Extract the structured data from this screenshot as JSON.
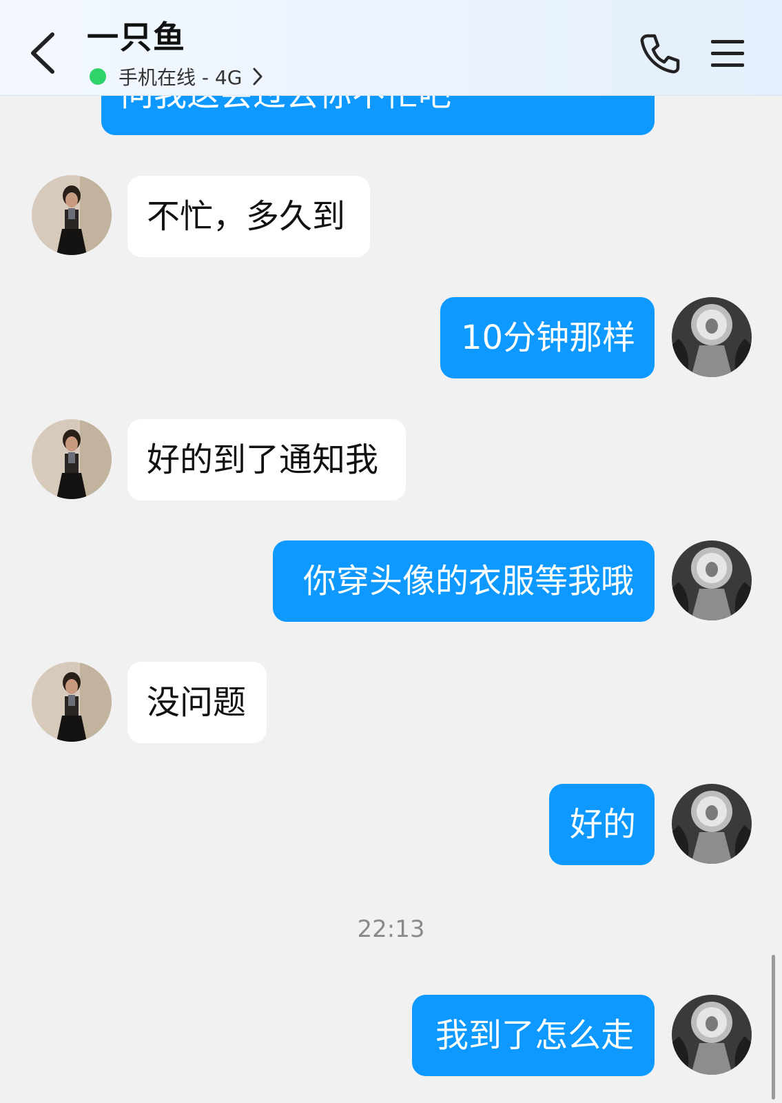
{
  "header": {
    "title": "一只鱼",
    "status": "手机在线 - 4G",
    "status_color": "#2fd36a",
    "back_icon": "back-chevron-icon",
    "call_icon": "phone-icon",
    "menu_icon": "menu-icon"
  },
  "messages": [
    {
      "from": "me",
      "text": "问我这会过去你不忙吧"
    },
    {
      "from": "other",
      "text": "不忙，多久到"
    },
    {
      "from": "me",
      "text": "10分钟那样"
    },
    {
      "from": "other",
      "text": "好的到了通知我"
    },
    {
      "from": "me",
      "text": "你穿头像的衣服等我哦"
    },
    {
      "from": "other",
      "text": "没问题"
    },
    {
      "from": "me",
      "text": "好的"
    },
    {
      "from": "me",
      "text": "我到了怎么走"
    }
  ],
  "timestamp": "22:13",
  "colors": {
    "outgoing_bubble": "#0d99ff",
    "incoming_bubble": "#ffffff",
    "background": "#f1f1f1"
  }
}
